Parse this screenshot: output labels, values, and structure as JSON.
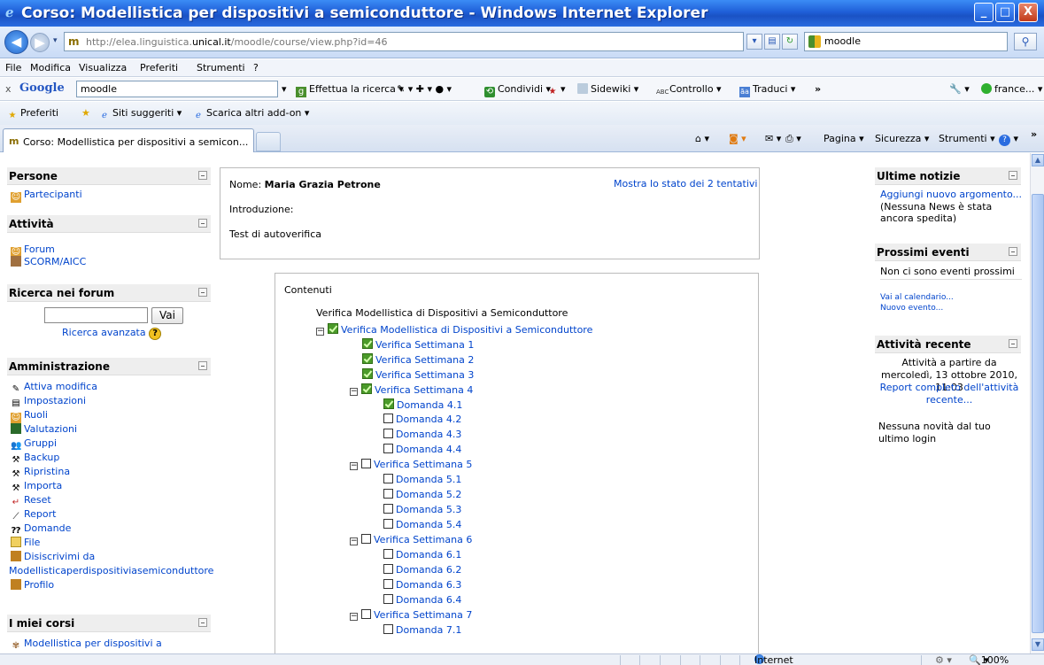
{
  "window": {
    "title": "Corso: Modellistica per dispositivi a semiconduttore - Windows Internet Explorer",
    "minimize": "_",
    "maximize": "□",
    "close": "X"
  },
  "address_bar": {
    "url_prefix": "http://elea.linguistica.",
    "url_domain": "unical.it",
    "url_suffix": "/moodle/course/view.php?id=46",
    "search_query": "moodle"
  },
  "menu": [
    "File",
    "Modifica",
    "Visualizza",
    "Preferiti",
    "Strumenti",
    "?"
  ],
  "google_toolbar": {
    "logo": "Google",
    "query": "moodle",
    "search_label": "Effettua la ricerca",
    "share_label": "Condividi",
    "sidewiki_label": "Sidewiki",
    "spell_label": "Controllo",
    "translate_label": "Traduci",
    "more_label": "»",
    "user_label": "france..."
  },
  "favorites_bar": {
    "favorites_label": "Preferiti",
    "suggested_sites": "Siti suggeriti ▾",
    "more_addons": "Scarica altri add-on ▾"
  },
  "tabs": {
    "active_tab": "Corso: Modellistica per dispositivi a semicon...",
    "commands": {
      "page": "Pagina ▾",
      "security": "Sicurezza ▾",
      "tools": "Strumenti ▾",
      "more": "»"
    }
  },
  "left_blocks": {
    "persone": {
      "title": "Persone",
      "items": [
        "Partecipanti"
      ]
    },
    "attivita": {
      "title": "Attività",
      "items": [
        "Forum",
        "SCORM/AICC"
      ]
    },
    "ricerca": {
      "title": "Ricerca nei forum",
      "button": "Vai",
      "advanced": "Ricerca avanzata"
    },
    "amministrazione": {
      "title": "Amministrazione",
      "items": [
        "Attiva modifica",
        "Impostazioni",
        "Ruoli",
        "Valutazioni",
        "Gruppi",
        "Backup",
        "Ripristina",
        "Importa",
        "Reset",
        "Report",
        "Domande",
        "File",
        "Disiscrivimi da",
        "Modellisticaperdispositiviasemiconduttore",
        "Profilo"
      ]
    },
    "miei_corsi": {
      "title": "I miei corsi",
      "items": [
        "Modellistica per dispositivi a"
      ]
    }
  },
  "main": {
    "name_label": "Nome:",
    "name_value": "Maria Grazia Petrone",
    "attempts_link": "Mostra lo stato dei 2 tentativi",
    "intro_label": "Introduzione:",
    "intro_text": "Test di autoverifica",
    "contents_label": "Contenuti",
    "root_title": "Verifica Modellistica di Dispositivi a Semiconduttore",
    "tree": [
      {
        "label": "Verifica Modellistica di Dispositivi a Semiconduttore",
        "level": 0,
        "toggle": "−",
        "done": true
      },
      {
        "label": "Verifica Settimana 1",
        "level": 1,
        "toggle": "",
        "done": true
      },
      {
        "label": "Verifica Settimana 2",
        "level": 1,
        "toggle": "",
        "done": true
      },
      {
        "label": "Verifica Settimana 3",
        "level": 1,
        "toggle": "",
        "done": true
      },
      {
        "label": "Verifica Settimana 4",
        "level": 1,
        "toggle": "−",
        "done": true
      },
      {
        "label": "Domanda 4.1",
        "level": 2,
        "toggle": "",
        "done": true
      },
      {
        "label": "Domanda 4.2",
        "level": 2,
        "toggle": "",
        "done": false
      },
      {
        "label": "Domanda 4.3",
        "level": 2,
        "toggle": "",
        "done": false
      },
      {
        "label": "Domanda 4.4",
        "level": 2,
        "toggle": "",
        "done": false
      },
      {
        "label": "Verifica Settimana 5",
        "level": 1,
        "toggle": "−",
        "done": false
      },
      {
        "label": "Domanda 5.1",
        "level": 2,
        "toggle": "",
        "done": false
      },
      {
        "label": "Domanda 5.2",
        "level": 2,
        "toggle": "",
        "done": false
      },
      {
        "label": "Domanda 5.3",
        "level": 2,
        "toggle": "",
        "done": false
      },
      {
        "label": "Domanda 5.4",
        "level": 2,
        "toggle": "",
        "done": false
      },
      {
        "label": "Verifica Settimana 6",
        "level": 1,
        "toggle": "−",
        "done": false
      },
      {
        "label": "Domanda 6.1",
        "level": 2,
        "toggle": "",
        "done": false
      },
      {
        "label": "Domanda 6.2",
        "level": 2,
        "toggle": "",
        "done": false
      },
      {
        "label": "Domanda 6.3",
        "level": 2,
        "toggle": "",
        "done": false
      },
      {
        "label": "Domanda 6.4",
        "level": 2,
        "toggle": "",
        "done": false
      },
      {
        "label": "Verifica Settimana 7",
        "level": 1,
        "toggle": "−",
        "done": false
      },
      {
        "label": "Domanda 7.1",
        "level": 2,
        "toggle": "",
        "done": false
      }
    ]
  },
  "right_blocks": {
    "notizie": {
      "title": "Ultime notizie",
      "add_link": "Aggiungi nuovo argomento...",
      "empty": "(Nessuna News è stata ancora spedita)"
    },
    "eventi": {
      "title": "Prossimi eventi",
      "empty": "Non ci sono eventi prossimi",
      "calendar": "Vai al calendario...",
      "new_event": "Nuovo evento..."
    },
    "recente": {
      "title": "Attività recente",
      "since": "Attività a partire da mercoledì, 13 ottobre 2010, 11:03",
      "report": "Report completo dell'attività recente...",
      "none": "Nessuna novità dal tuo ultimo login"
    }
  },
  "status_bar": {
    "zone": "Internet",
    "zoom": "100%"
  }
}
